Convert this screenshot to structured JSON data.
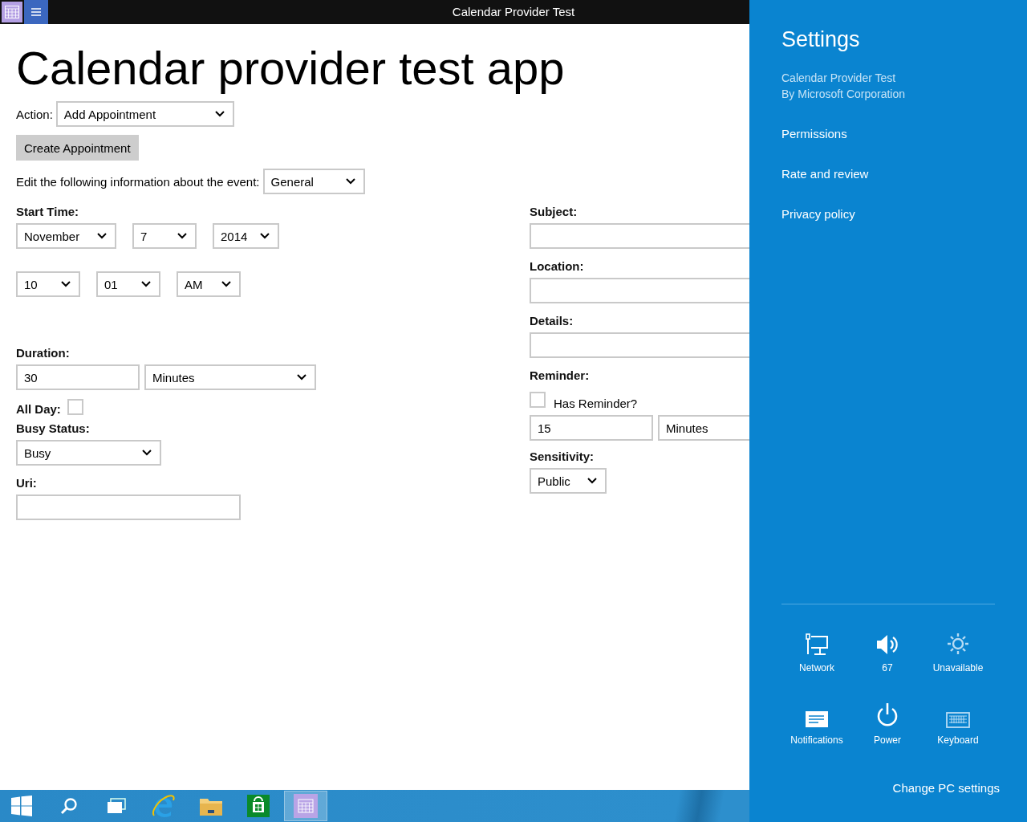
{
  "window": {
    "title": "Calendar Provider Test"
  },
  "heading": "Calendar provider test app",
  "action": {
    "label": "Action:",
    "value": "Add Appointment"
  },
  "create_button": "Create Appointment",
  "section": {
    "label": "Edit the following information about the event:",
    "value": "General"
  },
  "start_time": {
    "label": "Start Time:",
    "month": "November",
    "day": "7",
    "year": "2014",
    "hour": "10",
    "minute": "01",
    "period": "AM"
  },
  "duration": {
    "label": "Duration:",
    "value": "30",
    "unit": "Minutes"
  },
  "all_day": {
    "label": "All Day:",
    "checked": false
  },
  "busy_status": {
    "label": "Busy Status:",
    "value": "Busy"
  },
  "uri": {
    "label": "Uri:"
  },
  "subject": {
    "label": "Subject:"
  },
  "location": {
    "label": "Location:"
  },
  "details": {
    "label": "Details:"
  },
  "reminder": {
    "label": "Reminder:",
    "has_reminder": {
      "label": "Has Reminder?",
      "checked": false
    },
    "value": "15",
    "unit": "Minutes"
  },
  "sensitivity": {
    "label": "Sensitivity:",
    "value": "Public"
  },
  "settings": {
    "title": "Settings",
    "app_name": "Calendar Provider Test",
    "publisher": "By Microsoft Corporation",
    "links": [
      "Permissions",
      "Rate and review",
      "Privacy policy"
    ],
    "quick_settings": [
      {
        "kind": "network",
        "label": "Network",
        "disabled": false
      },
      {
        "kind": "volume",
        "label": "67",
        "disabled": false
      },
      {
        "kind": "brightness",
        "label": "Unavailable",
        "disabled": true
      },
      {
        "kind": "notifications",
        "label": "Notifications",
        "disabled": false
      },
      {
        "kind": "power",
        "label": "Power",
        "disabled": false
      },
      {
        "kind": "keyboard",
        "label": "Keyboard",
        "disabled": true
      }
    ],
    "change_pc_settings": "Change PC settings"
  },
  "taskbar": {
    "items": [
      {
        "kind": "start",
        "selected": false
      },
      {
        "kind": "search",
        "selected": false
      },
      {
        "kind": "task-view",
        "selected": false
      },
      {
        "kind": "browser",
        "selected": false
      },
      {
        "kind": "files",
        "selected": false
      },
      {
        "kind": "store",
        "selected": false
      },
      {
        "kind": "calendar",
        "selected": true
      }
    ]
  }
}
